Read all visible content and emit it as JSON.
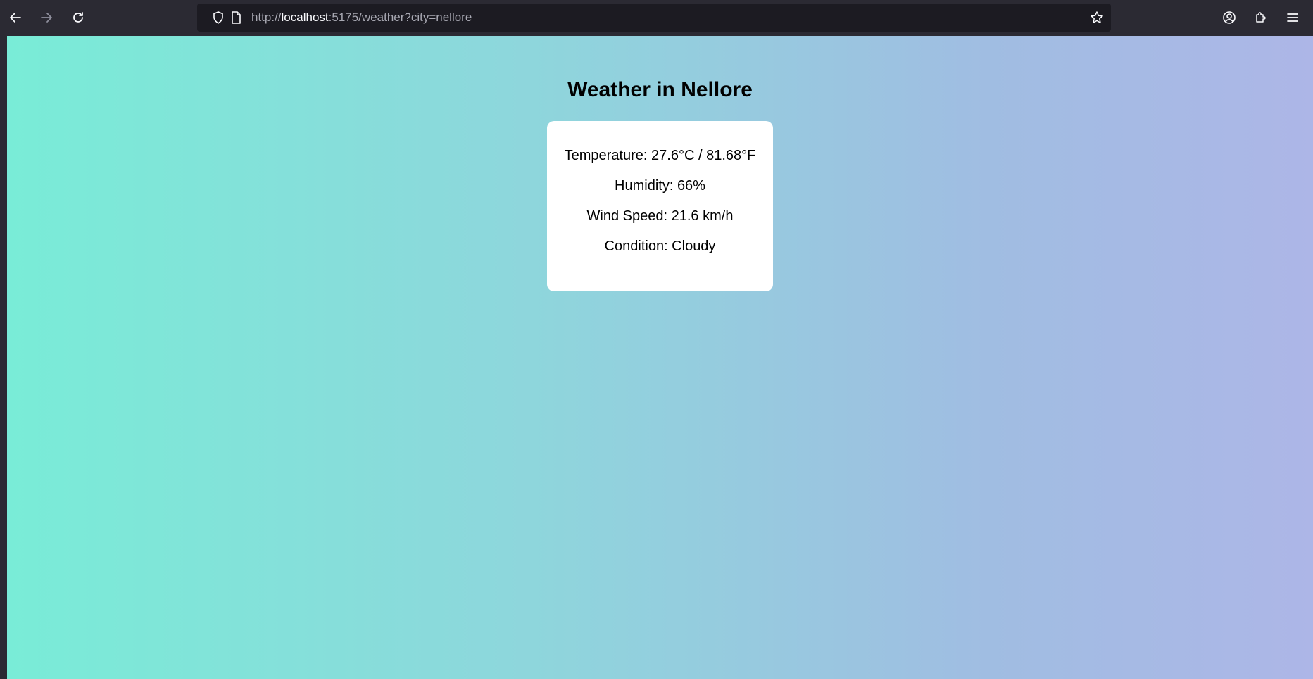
{
  "browser": {
    "url_scheme": "http://",
    "url_host": "localhost",
    "url_rest": ":5175/weather?city=nellore"
  },
  "page": {
    "title": "Weather in Nellore",
    "weather": {
      "temperature": "Temperature: 27.6°C / 81.68°F",
      "humidity": "Humidity: 66%",
      "wind": "Wind Speed: 21.6 km/h",
      "condition": "Condition: Cloudy"
    }
  },
  "colors": {
    "gradient_start": "#79ecd7",
    "gradient_end": "#adb6e7",
    "card_bg": "#ffffff",
    "toolbar_bg": "#2b2a33"
  }
}
